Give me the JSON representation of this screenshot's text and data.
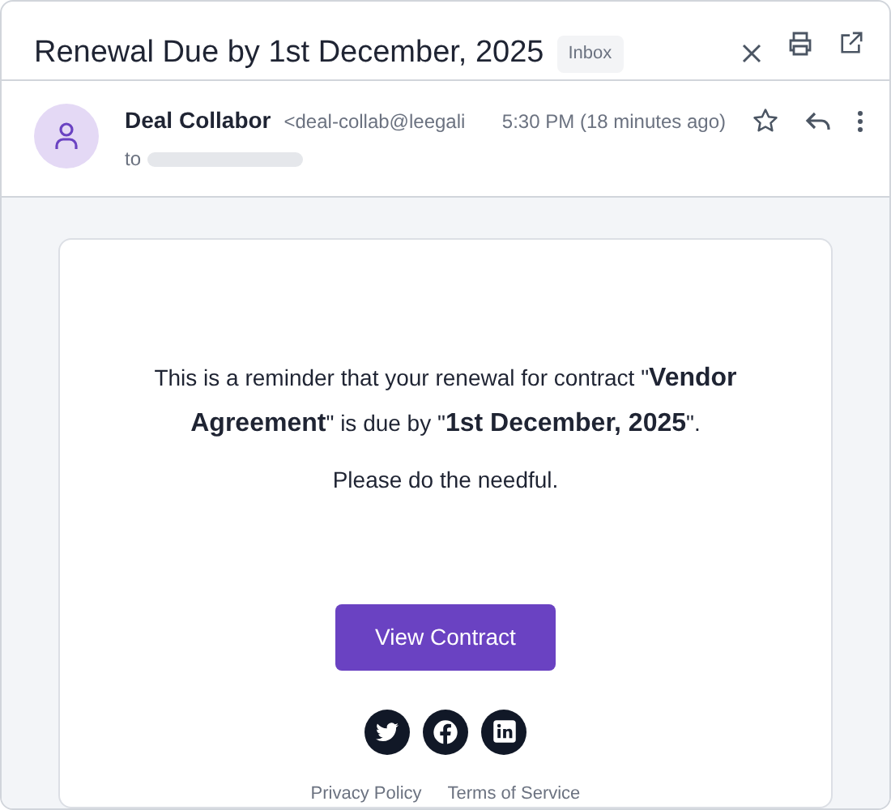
{
  "header": {
    "subject": "Renewal Due by 1st December, 2025",
    "label": "Inbox"
  },
  "message": {
    "sender_name": "Deal Collabor",
    "sender_email": "<deal-collab@leegali",
    "time": "5:30 PM (18 minutes ago)",
    "to_label": "to",
    "starred": false
  },
  "body": {
    "paragraphs": [
      "This is a reminder that your renewal for contract \"**Vendor Agreement**\" is due by \"**1st December, 2025**\".",
      "Please do the needful."
    ],
    "button": "View Contract",
    "social": [
      {
        "kind": "twitter"
      },
      {
        "kind": "facebook"
      },
      {
        "kind": "linkedin"
      }
    ],
    "footer_links": [
      "Privacy Policy",
      "Terms of Service"
    ]
  }
}
